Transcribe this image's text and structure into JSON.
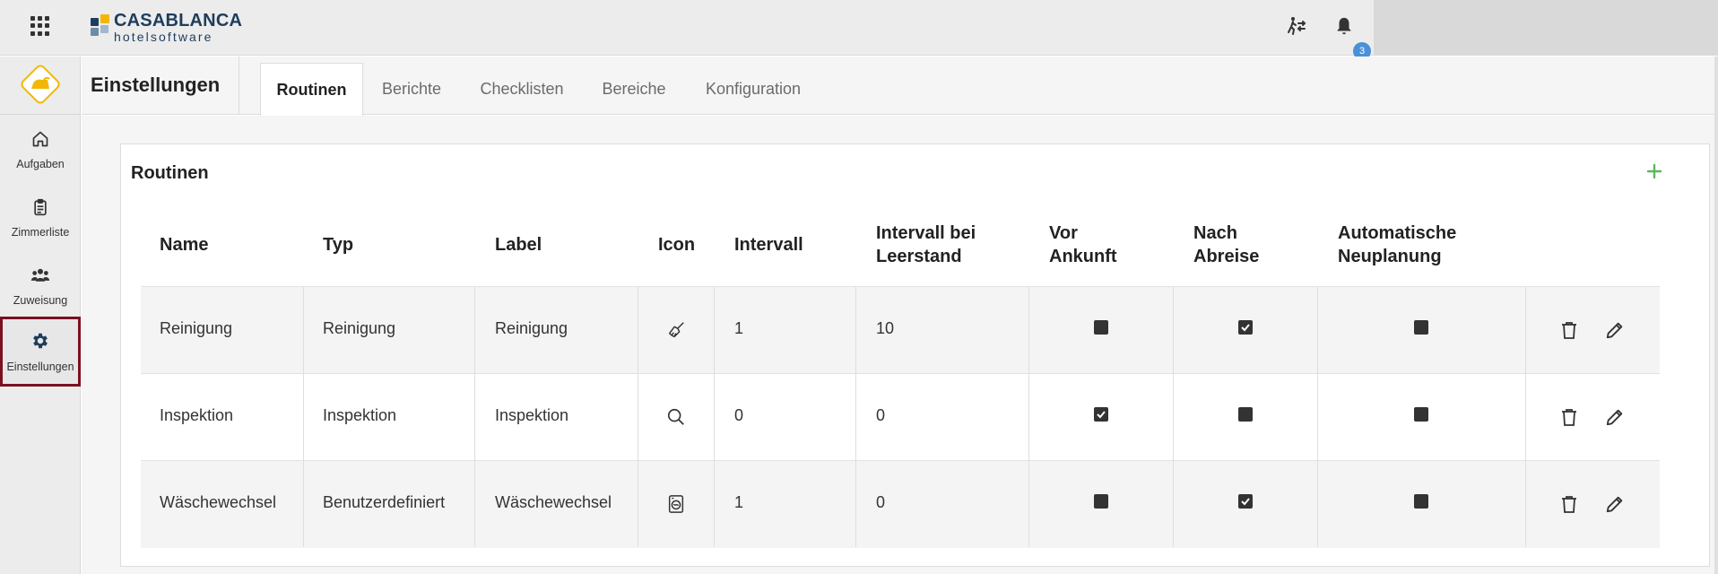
{
  "brand": {
    "name_line1": "CASABLANCA",
    "name_line2": "hotelsoftware"
  },
  "topbar": {
    "apps_icon": "grid-icon",
    "transfer_icon": "person-switch-icon",
    "notifications_icon": "bell-icon",
    "notifications_count": "3"
  },
  "sidebar": {
    "items": [
      {
        "label": "Aufgaben",
        "icon": "home-icon"
      },
      {
        "label": "Zimmerliste",
        "icon": "clipboard-icon"
      },
      {
        "label": "Zuweisung",
        "icon": "users-icon"
      },
      {
        "label": "Einstellungen",
        "icon": "gear-icon",
        "active": true
      }
    ]
  },
  "header": {
    "title": "Einstellungen",
    "tabs": [
      {
        "label": "Routinen",
        "active": true
      },
      {
        "label": "Berichte"
      },
      {
        "label": "Checklisten"
      },
      {
        "label": "Bereiche"
      },
      {
        "label": "Konfiguration"
      }
    ]
  },
  "card": {
    "title": "Routinen",
    "add_icon": "plus-icon"
  },
  "table": {
    "columns": [
      {
        "line1": "Name",
        "line2": ""
      },
      {
        "line1": "Typ",
        "line2": ""
      },
      {
        "line1": "Label",
        "line2": ""
      },
      {
        "line1": "Icon",
        "line2": ""
      },
      {
        "line1": "Intervall",
        "line2": ""
      },
      {
        "line1": "Intervall bei",
        "line2": "Leerstand"
      },
      {
        "line1": "Vor",
        "line2": "Ankunft"
      },
      {
        "line1": "Nach",
        "line2": "Abreise"
      },
      {
        "line1": "Automatische",
        "line2": "Neuplanung"
      }
    ],
    "rows": [
      {
        "name": "Reinigung",
        "typ": "Reinigung",
        "label": "Reinigung",
        "icon": "broom-icon",
        "intervall": "1",
        "leerstand": "10",
        "vor_ankunft": false,
        "nach_abreise": true,
        "neuplanung": false
      },
      {
        "name": "Inspektion",
        "typ": "Inspektion",
        "label": "Inspektion",
        "icon": "magnifier-icon",
        "intervall": "0",
        "leerstand": "0",
        "vor_ankunft": true,
        "nach_abreise": false,
        "neuplanung": false
      },
      {
        "name": "Wäschewechsel",
        "typ": "Benutzerdefiniert",
        "label": "Wäschewechsel",
        "icon": "washing-machine-icon",
        "intervall": "1",
        "leerstand": "0",
        "vor_ankunft": false,
        "nach_abreise": true,
        "neuplanung": false
      }
    ],
    "row_actions": [
      "trash-icon",
      "pencil-icon"
    ]
  },
  "colors": {
    "accent_active": "#7a1020",
    "badge": "#4a90d9",
    "add": "#5cb85c",
    "logo_yellow": "#f2b705"
  }
}
